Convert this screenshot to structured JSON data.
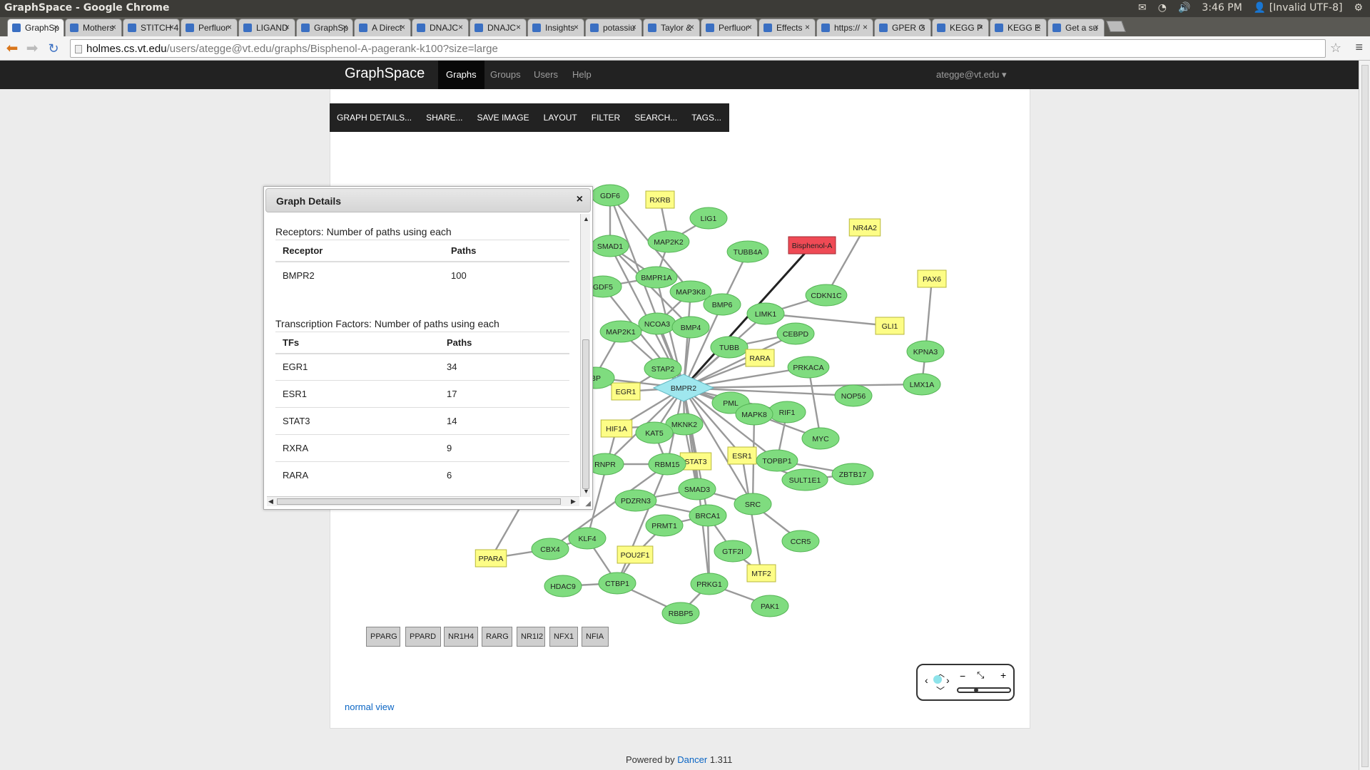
{
  "os": {
    "window_title": "GraphSpace - Google Chrome",
    "time": "3:46 PM",
    "user": "[Invalid UTF-8]"
  },
  "tabs": [
    {
      "label": "GraphSp",
      "active": true
    },
    {
      "label": "Mothers"
    },
    {
      "label": "STITCH 4"
    },
    {
      "label": "Perfluor"
    },
    {
      "label": "LIGAND"
    },
    {
      "label": "GraphSp"
    },
    {
      "label": "A Direct"
    },
    {
      "label": "DNAJC"
    },
    {
      "label": "DNAJC"
    },
    {
      "label": "Insights"
    },
    {
      "label": "potassiu"
    },
    {
      "label": "Taylor &"
    },
    {
      "label": "Perfluor"
    },
    {
      "label": "Effects"
    },
    {
      "label": "https://"
    },
    {
      "label": "GPER G"
    },
    {
      "label": "KEGG P"
    },
    {
      "label": "KEGG E"
    },
    {
      "label": "Get a su"
    }
  ],
  "address": {
    "host": "holmes.cs.vt.edu",
    "path": "/users/ategge@vt.edu/graphs/Bisphenol-A-pagerank-k100?size=large"
  },
  "site_nav": {
    "brand": "GraphSpace",
    "links": [
      "Graphs",
      "Groups",
      "Users",
      "Help"
    ],
    "active": "Graphs",
    "user": "ategge@vt.edu"
  },
  "graph_menu": [
    "GRAPH DETAILS...",
    "SHARE...",
    "SAVE IMAGE",
    "LAYOUT",
    "FILTER",
    "SEARCH...",
    "TAGS..."
  ],
  "dialog": {
    "title": "Graph Details",
    "close": "×",
    "receptors_title": "Receptors: Number of paths using each",
    "receptors_headers": [
      "Receptor",
      "Paths"
    ],
    "receptors_rows": [
      [
        "BMPR2",
        "100"
      ]
    ],
    "tf_title": "Transcription Factors: Number of paths using each",
    "tf_headers": [
      "TFs",
      "Paths"
    ],
    "tf_rows": [
      [
        "EGR1",
        "34"
      ],
      [
        "ESR1",
        "17"
      ],
      [
        "STAT3",
        "14"
      ],
      [
        "RXRA",
        "9"
      ],
      [
        "RARA",
        "6"
      ]
    ]
  },
  "graph": {
    "nodes": [
      {
        "id": "GDF6",
        "shape": "ellipse"
      },
      {
        "id": "RXRB",
        "shape": "rect"
      },
      {
        "id": "LIG1",
        "shape": "ellipse"
      },
      {
        "id": "NR4A2",
        "shape": "rect"
      },
      {
        "id": "Bisphenol-A",
        "shape": "source"
      },
      {
        "id": "SMAD1",
        "shape": "ellipse"
      },
      {
        "id": "MAP2K2",
        "shape": "ellipse"
      },
      {
        "id": "TUBB4A",
        "shape": "ellipse"
      },
      {
        "id": "PAX6",
        "shape": "rect"
      },
      {
        "id": "BMPR1A",
        "shape": "ellipse"
      },
      {
        "id": "GDF5",
        "shape": "ellipse"
      },
      {
        "id": "MAP3K8",
        "shape": "ellipse"
      },
      {
        "id": "CDKN1C",
        "shape": "ellipse"
      },
      {
        "id": "BMP6",
        "shape": "ellipse"
      },
      {
        "id": "LIMK1",
        "shape": "ellipse"
      },
      {
        "id": "NCOA3",
        "shape": "ellipse"
      },
      {
        "id": "MAP2K1",
        "shape": "ellipse"
      },
      {
        "id": "BMP4",
        "shape": "ellipse"
      },
      {
        "id": "CEBPD",
        "shape": "ellipse"
      },
      {
        "id": "GLI1",
        "shape": "rect"
      },
      {
        "id": "TUBB",
        "shape": "ellipse"
      },
      {
        "id": "KPNA3",
        "shape": "ellipse"
      },
      {
        "id": "RARA",
        "shape": "rect"
      },
      {
        "id": "STAP2",
        "shape": "ellipse"
      },
      {
        "id": "PRKACA",
        "shape": "ellipse"
      },
      {
        "id": "BMPR2",
        "shape": "diamond"
      },
      {
        "id": "LMX1A",
        "shape": "ellipse"
      },
      {
        "id": "EGR1",
        "shape": "rect"
      },
      {
        "id": "NOP56",
        "shape": "ellipse"
      },
      {
        "id": "PML",
        "shape": "ellipse"
      },
      {
        "id": "RIF1",
        "shape": "ellipse"
      },
      {
        "id": "MAPK8",
        "shape": "ellipse"
      },
      {
        "id": "HIF1A",
        "shape": "rect"
      },
      {
        "id": "MKNK2",
        "shape": "ellipse"
      },
      {
        "id": "KAT5",
        "shape": "ellipse"
      },
      {
        "id": "MYC",
        "shape": "ellipse"
      },
      {
        "id": "ESR1",
        "shape": "rect"
      },
      {
        "id": "STAT3",
        "shape": "rect"
      },
      {
        "id": "RBM15",
        "shape": "ellipse"
      },
      {
        "id": "TOPBP1",
        "shape": "ellipse"
      },
      {
        "id": "ZBTB17",
        "shape": "ellipse"
      },
      {
        "id": "RNPR",
        "shape": "ellipse"
      },
      {
        "id": "SULT1E1",
        "shape": "ellipse"
      },
      {
        "id": "SMAD3",
        "shape": "ellipse"
      },
      {
        "id": "PDZRN3",
        "shape": "ellipse"
      },
      {
        "id": "SRC",
        "shape": "ellipse"
      },
      {
        "id": "BRCA1",
        "shape": "ellipse"
      },
      {
        "id": "PRMT1",
        "shape": "ellipse"
      },
      {
        "id": "KLF4",
        "shape": "ellipse"
      },
      {
        "id": "CCR5",
        "shape": "ellipse"
      },
      {
        "id": "CBX4",
        "shape": "ellipse"
      },
      {
        "id": "PPARA",
        "shape": "rect"
      },
      {
        "id": "POU2F1",
        "shape": "rect"
      },
      {
        "id": "GTF2I",
        "shape": "ellipse"
      },
      {
        "id": "MTF2",
        "shape": "rect"
      },
      {
        "id": "HDAC9",
        "shape": "ellipse"
      },
      {
        "id": "CTBP1",
        "shape": "ellipse"
      },
      {
        "id": "PRKG1",
        "shape": "ellipse"
      },
      {
        "id": "PAK1",
        "shape": "ellipse"
      },
      {
        "id": "RBBP5",
        "shape": "ellipse"
      },
      {
        "id": "BP",
        "shape": "ellipse"
      }
    ],
    "edges": [
      [
        "Bisphenol-A",
        "BMPR2"
      ],
      [
        "BMPR2",
        "EGR1"
      ],
      [
        "BMPR2",
        "STAP2"
      ],
      [
        "BMPR2",
        "MKNK2"
      ],
      [
        "BMPR2",
        "PML"
      ],
      [
        "BMPR2",
        "MAPK8"
      ],
      [
        "BMPR2",
        "RIF1"
      ],
      [
        "BMPR2",
        "NOP56"
      ],
      [
        "BMPR2",
        "LMX1A"
      ],
      [
        "BMPR2",
        "PRKACA"
      ],
      [
        "BMPR2",
        "RARA"
      ],
      [
        "BMPR2",
        "TUBB"
      ],
      [
        "BMPR2",
        "BMP4"
      ],
      [
        "BMPR2",
        "NCOA3"
      ],
      [
        "BMPR2",
        "MAP2K1"
      ],
      [
        "BMPR2",
        "BMPR1A"
      ],
      [
        "BMPR2",
        "SMAD1"
      ],
      [
        "BMPR2",
        "GDF6"
      ],
      [
        "BMPR2",
        "GDF5"
      ],
      [
        "BMPR2",
        "MAP3K8"
      ],
      [
        "BMPR2",
        "BMP6"
      ],
      [
        "BMPR2",
        "LIMK1"
      ],
      [
        "BMPR2",
        "CEBPD"
      ],
      [
        "BMPR2",
        "KAT5"
      ],
      [
        "BMPR2",
        "HIF1A"
      ],
      [
        "BMPR2",
        "RBM15"
      ],
      [
        "BMPR2",
        "STAT3"
      ],
      [
        "BMPR2",
        "SMAD3"
      ],
      [
        "BMPR2",
        "ESR1"
      ],
      [
        "BMPR2",
        "TOPBP1"
      ],
      [
        "BMPR2",
        "MYC"
      ],
      [
        "BMPR2",
        "SRC"
      ],
      [
        "BMPR2",
        "BRCA1"
      ],
      [
        "BMPR2",
        "RNPR"
      ],
      [
        "BMPR2",
        "BP"
      ],
      [
        "MAP2K2",
        "RXRB"
      ],
      [
        "MAP2K2",
        "LIG1"
      ],
      [
        "MAP2K2",
        "BMPR1A"
      ],
      [
        "BMP6",
        "TUBB4A"
      ],
      [
        "LIMK1",
        "CDKN1C"
      ],
      [
        "CDKN1C",
        "NR4A2"
      ],
      [
        "KPNA3",
        "PAX6"
      ],
      [
        "LIMK1",
        "GLI1"
      ],
      [
        "KPNA3",
        "LMX1A"
      ],
      [
        "MAP2K1",
        "BMP4"
      ],
      [
        "NCOA3",
        "MAP3K8"
      ],
      [
        "SMAD1",
        "BMPR1A"
      ],
      [
        "GDF5",
        "BMPR1A"
      ],
      [
        "GDF6",
        "SMAD1"
      ],
      [
        "TUBB",
        "CEBPD"
      ],
      [
        "RIF1",
        "TOPBP1"
      ],
      [
        "TOPBP1",
        "ZBTB17"
      ],
      [
        "ESR1",
        "SULT1E1"
      ],
      [
        "SULT1E1",
        "ZBTB17"
      ],
      [
        "MYC",
        "PRKACA"
      ],
      [
        "SRC",
        "CCR5"
      ],
      [
        "SMAD3",
        "PDZRN3"
      ],
      [
        "BRCA1",
        "PRMT1"
      ],
      [
        "BRCA1",
        "GTF2I"
      ],
      [
        "GTF2I",
        "MTF2"
      ],
      [
        "BRCA1",
        "PRKG1"
      ],
      [
        "PRKG1",
        "PAK1"
      ],
      [
        "PRKG1",
        "RBBP5"
      ],
      [
        "CTBP1",
        "RBBP5"
      ],
      [
        "CTBP1",
        "HDAC9"
      ],
      [
        "CTBP1",
        "KLF4"
      ],
      [
        "KLF4",
        "CBX4"
      ],
      [
        "CBX4",
        "PPARA"
      ],
      [
        "POU2F1",
        "CTBP1"
      ],
      [
        "POU2F1",
        "PRMT1"
      ],
      [
        "KLF4",
        "HIF1A"
      ],
      [
        "RNPR",
        "RBM15"
      ],
      [
        "STAT3",
        "SMAD3"
      ],
      [
        "PDZRN3",
        "BRCA1"
      ],
      [
        "MAPK8",
        "SRC"
      ],
      [
        "MAPK8",
        "RIF1"
      ],
      [
        "STAP2",
        "EGR1"
      ],
      [
        "MKNK2",
        "SMAD3"
      ],
      [
        "PML",
        "MAPK8"
      ],
      [
        "KAT5",
        "RBM15"
      ],
      [
        "HIF1A",
        "MKNK2"
      ],
      [
        "EGR1",
        "BP"
      ],
      [
        "RBM15",
        "CTBP1"
      ],
      [
        "GDF6",
        "MAP3K8"
      ],
      [
        "SMAD1",
        "BMP4"
      ],
      [
        "MTF2",
        "ESR1"
      ],
      [
        "CBX4",
        "RBM15"
      ],
      [
        "PPARA",
        "MAP2K1"
      ],
      [
        "STAT3",
        "PRKG1"
      ],
      [
        "SMAD3",
        "SRC"
      ]
    ]
  },
  "legend_boxes": [
    "PPARG",
    "PPARD",
    "NR1H4",
    "RARG",
    "NR1I2",
    "NFX1",
    "NFIA"
  ],
  "links": {
    "normal_view": "normal view"
  },
  "footer": {
    "prefix": "Powered by",
    "link": "Dancer",
    "version": "1.311"
  },
  "colors": {
    "node_fill": "#7fdc7f",
    "rect_fill": "#fdfd86",
    "source_fill": "#ef4a55",
    "receptor_fill": "#9fe7ee"
  }
}
